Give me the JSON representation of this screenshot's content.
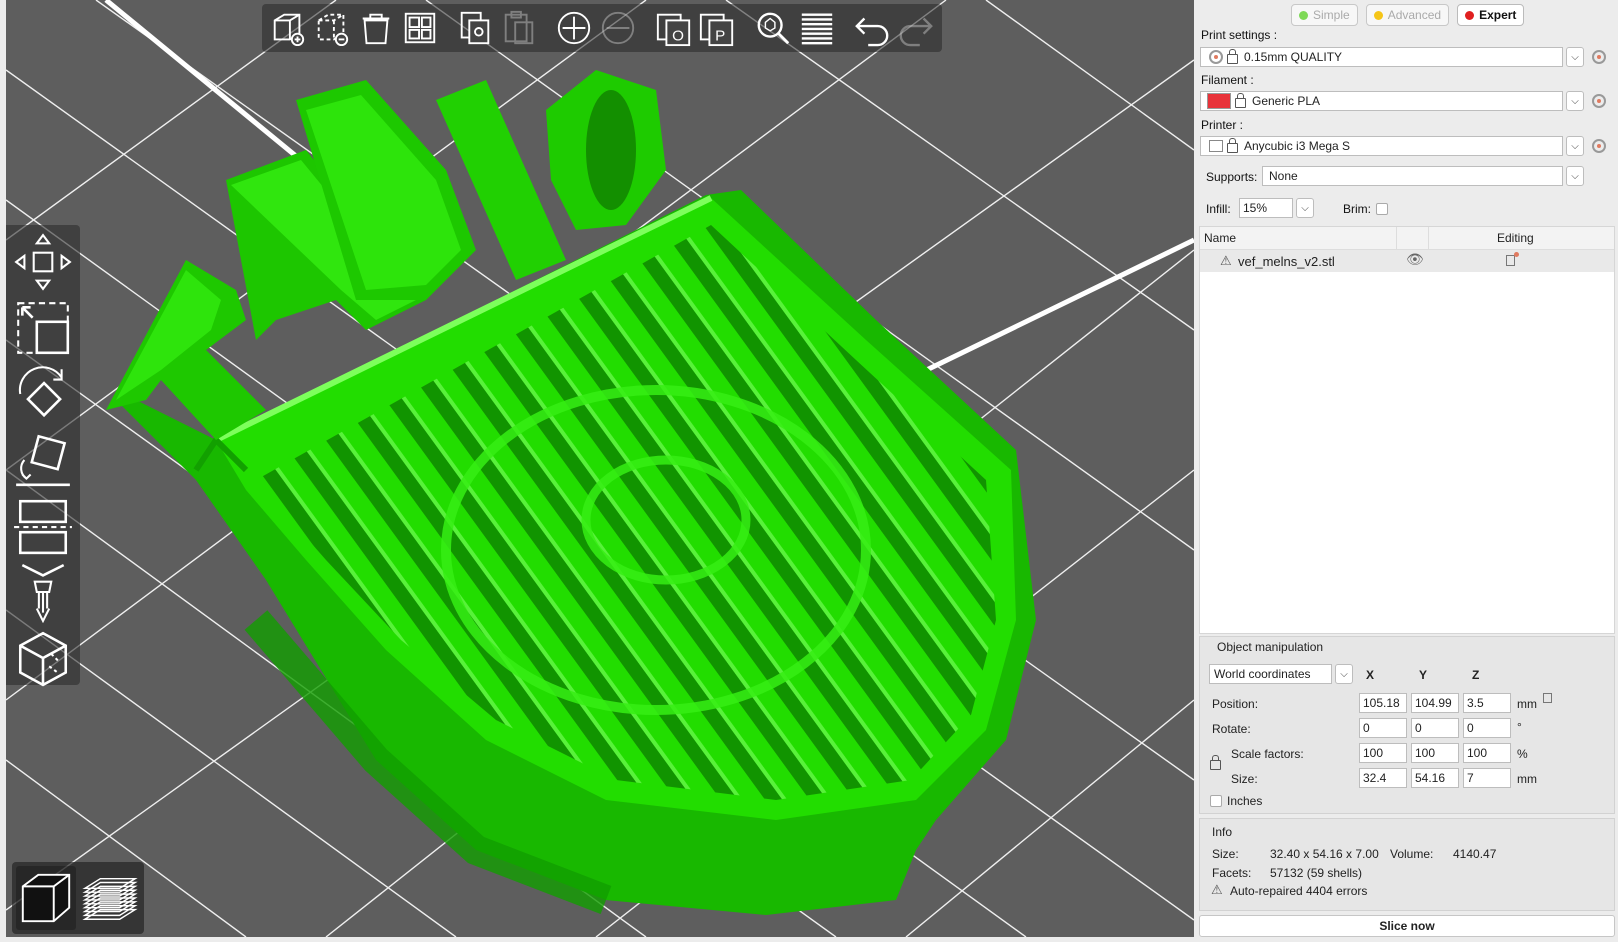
{
  "viewport": {
    "model_text": "RADIO",
    "model_color": "#22dd00",
    "bed_color": "#5e5e5e",
    "grid_color": "#ffffff"
  },
  "toolbar_top": {
    "buttons": [
      {
        "name": "add-icon",
        "enabled": true
      },
      {
        "name": "delete-icon",
        "enabled": true
      },
      {
        "name": "delete-all-icon",
        "enabled": true
      },
      {
        "name": "arrange-icon",
        "enabled": true
      },
      {
        "name": "copy-icon",
        "enabled": true
      },
      {
        "name": "paste-icon",
        "enabled": false
      },
      {
        "name": "add-instance-icon",
        "enabled": true
      },
      {
        "name": "remove-instance-icon",
        "enabled": false
      },
      {
        "name": "split-objects-icon",
        "enabled": true
      },
      {
        "name": "split-parts-icon",
        "enabled": true
      },
      {
        "name": "search-icon",
        "enabled": true
      },
      {
        "name": "layers-editing-icon",
        "enabled": true
      },
      {
        "name": "undo-icon",
        "enabled": true
      },
      {
        "name": "redo-icon",
        "enabled": false
      }
    ]
  },
  "toolbar_left": [
    "move-icon",
    "scale-icon",
    "rotate-icon",
    "place-on-face-icon",
    "cut-icon",
    "paint-supports-icon",
    "seam-painting-icon"
  ],
  "view_switch": [
    "3d-view-icon",
    "preview-icon"
  ],
  "mode": {
    "simple": "Simple",
    "advanced": "Advanced",
    "expert": "Expert",
    "simple_color": "#7ed957",
    "advanced_color": "#f5c518",
    "expert_color": "#e02020"
  },
  "print_settings": {
    "label": "Print settings :",
    "value": "0.15mm QUALITY"
  },
  "filament": {
    "label": "Filament :",
    "value": "Generic PLA",
    "swatch": "#e8333a"
  },
  "printer": {
    "label": "Printer :",
    "value": "Anycubic i3 Mega S"
  },
  "supports": {
    "label": "Supports:",
    "value": "None"
  },
  "infill": {
    "label": "Infill:",
    "value": "15%"
  },
  "brim": {
    "label": "Brim:"
  },
  "object_list": {
    "col_name": "Name",
    "col_editing": "Editing",
    "rows": [
      {
        "name": "vef_melns_v2.stl"
      }
    ]
  },
  "manipulation": {
    "title": "Object manipulation",
    "coord_system": "World coordinates",
    "x": "X",
    "y": "Y",
    "z": "Z",
    "position": {
      "label": "Position:",
      "x": "105.18",
      "y": "104.99",
      "z": "3.5",
      "unit": "mm"
    },
    "rotate": {
      "label": "Rotate:",
      "x": "0",
      "y": "0",
      "z": "0",
      "unit": "°"
    },
    "scale": {
      "label": "Scale factors:",
      "x": "100",
      "y": "100",
      "z": "100",
      "unit": "%"
    },
    "size": {
      "label": "Size:",
      "x": "32.4",
      "y": "54.16",
      "z": "7",
      "unit": "mm"
    },
    "inches": "Inches"
  },
  "info": {
    "title": "Info",
    "size_label": "Size:",
    "size_value": "32.40 x 54.16 x 7.00",
    "volume_label": "Volume:",
    "volume_value": "4140.47",
    "facets_label": "Facets:",
    "facets_value": "57132 (59 shells)",
    "warning": "Auto-repaired 4404 errors"
  },
  "slice_button": "Slice now"
}
